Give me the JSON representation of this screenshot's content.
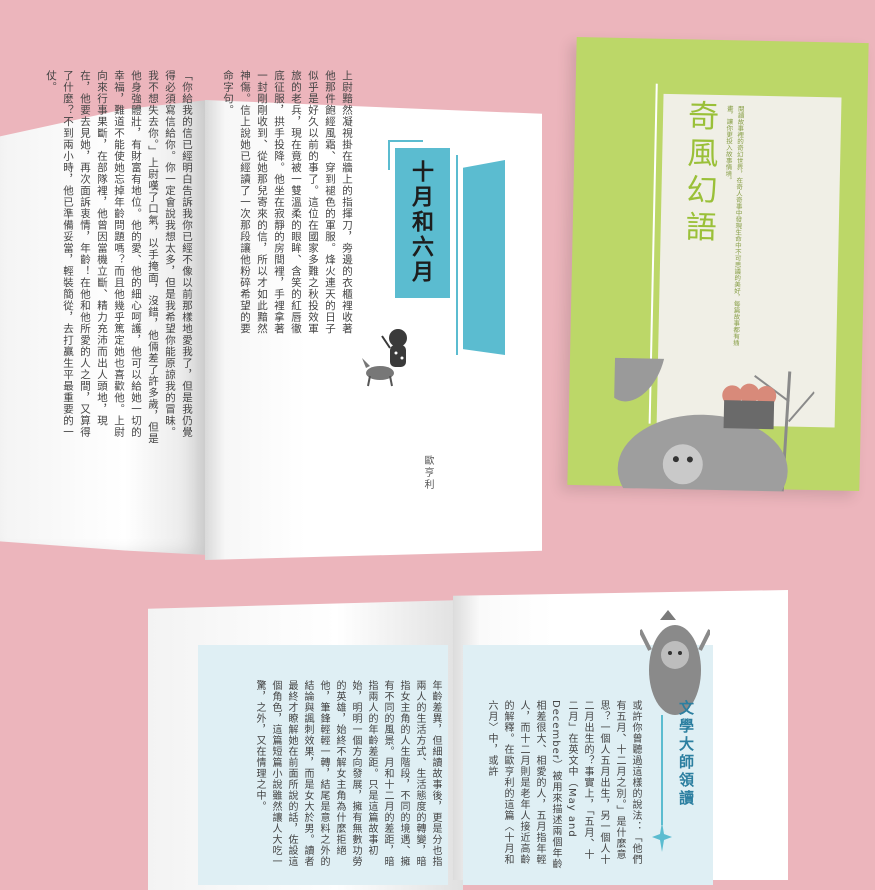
{
  "top_book": {
    "title": "十月和六月",
    "author": "歐亨利",
    "left_page_text": "「你給我的信已經明白告訴我你已經不像以前那樣地愛我了，但是我仍覺得必須寫信給你。你一定會說我想太多，但是我希望你能原諒我的冒昧。我不想失去你。」上尉嘆了口氣，以手掩面，沒錯，他倆差了許多歲，但是他身強體壯，有財富有地位。他的愛、他的細心呵護，他可以給她一切的幸福，難道不能使她忘掉年齡問題嗎？而且他幾乎篤定她也喜歡他。上尉向來行事果斷，在部隊裡，他曾因當機立斷、精力充沛而出人頭地，現在，他要去見她，再次面訴衷情，年齡！在他和他所愛的人之間，又算得了什麼？不到兩小時，他已準備妥當，輕裝簡從，去打贏生平最重要的一仗。",
    "right_page_text": "上尉黯然凝視掛在牆上的指揮刀，旁邊的衣櫃裡收著他那件飽經風霜、穿到褪色的軍服。烽火連天的日子似乎是好久以前的事了。這位在國家多難之秋投效軍旅的老兵，現在竟被一雙溫柔的眼眸、含笑的紅唇徹底征服，拱手投降。他坐在寂靜的房間裡，手裡拿著一封剛剛收到、從她那兒寄來的信，所以才如此黯然神傷。信上說她已經讀了一次那段讓他粉碎希望的要命字句。"
  },
  "magazine": {
    "title": "奇風幻語",
    "description": "閱讀故事裡的奇幻世界，在奇人奇事中發現生命中不可思議的美好，每篇故事都有插畫，讓你更投入故事情境。"
  },
  "bottom_book": {
    "heading": "文學大師領讀",
    "left_page_text": "年齡差異，但細讀故事後，更是分也指兩人的生活方式、生活態度的轉變，暗指女主角的人生階段，不同的境遇、擁有不同的風景。月和十二月的差距，暗指兩人的年齡差距。只是這篇故事初始，明明一個方向發展，擁有無數功勞的英雄，始終不解女主角為什麼拒絕他，筆鋒輕輕一轉，結尾是意料之外的結論與諷刺效果，而是女大於男。讀者最終才瞭解她在前面所說的話，佐設這個角色，這篇短篇小說雖然讓人大吃一驚，之外，又在情理之中。",
    "right_page_text": "或許你曾聽過這樣的說法：「他們有五月、十二月之別。」是什麼意思？一個人五月出生，另一個人十二月出生的？事實上，「五月、十二月」在英文中（May and December）被用來描述兩個年齡相差很大、相愛的人，五月指年輕人，而十二月則是老年人接近高齡的解釋。在歐亨利的這篇〈十月和六月〉中，或許"
  },
  "colors": {
    "background": "#ecb5bc",
    "accent_blue": "#5bbcd0",
    "magazine_green": "#bcd768",
    "panel_blue": "#dfeff4"
  }
}
